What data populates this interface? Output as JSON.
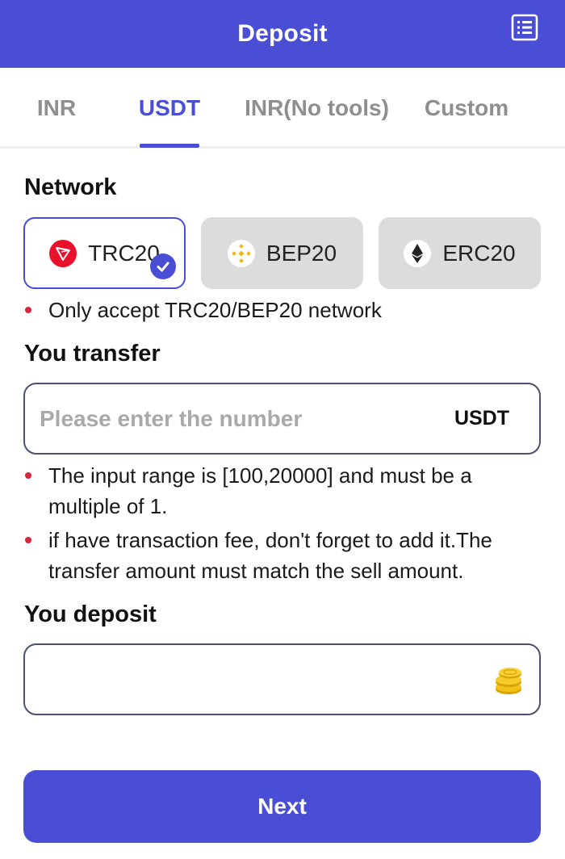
{
  "header": {
    "title": "Deposit",
    "menu_icon": "list-icon"
  },
  "tabs": [
    {
      "label": "INR",
      "active": false
    },
    {
      "label": "USDT",
      "active": true
    },
    {
      "label": "INR(No tools)",
      "active": false
    },
    {
      "label": "Custom",
      "active": false
    }
  ],
  "network": {
    "label": "Network",
    "options": [
      {
        "label": "TRC20",
        "icon": "tron-icon",
        "selected": true
      },
      {
        "label": "BEP20",
        "icon": "bnb-icon",
        "selected": false
      },
      {
        "label": "ERC20",
        "icon": "ethereum-icon",
        "selected": false
      }
    ],
    "note": "Only accept TRC20/BEP20 network"
  },
  "transfer": {
    "label": "You transfer",
    "placeholder": "Please enter the number",
    "value": "",
    "unit": "USDT",
    "notes": [
      "The input range is [100,20000] and must be a",
      "multiple of 1.",
      "if have transaction fee, don't forget to add it.The",
      "transfer amount must match the sell amount."
    ]
  },
  "deposit": {
    "label": "You deposit",
    "value": "",
    "icon": "coins-icon"
  },
  "next_label": "Next",
  "colors": {
    "accent": "#4a4ed4",
    "bullet": "#d7263d",
    "inactive_bg": "#dcdcdc"
  }
}
